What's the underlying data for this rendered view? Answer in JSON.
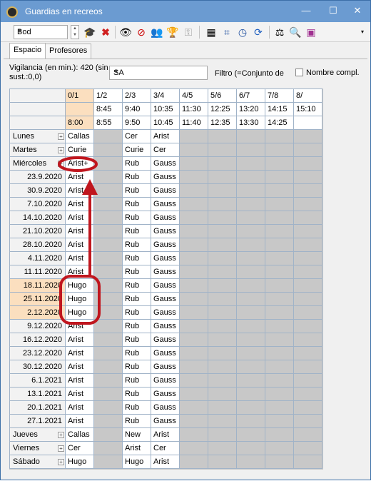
{
  "window": {
    "title": "Guardias en recreos"
  },
  "toolbar": {
    "combo_value": "Bod",
    "icons": [
      "graduation-cap-icon",
      "delete-x-icon",
      "eye-icon",
      "eye-crossed-icon",
      "people-icon",
      "trophy-icon",
      "key-icon",
      "calculator-icon",
      "crop-icon",
      "clock-icon",
      "refresh-icon",
      "scale-icon",
      "report-icon",
      "card-icon"
    ]
  },
  "tabs": [
    {
      "label": "Espacio"
    },
    {
      "label": "Profesores"
    }
  ],
  "filters": {
    "vigilancia_label": "Vigilancia (en min.): 420 (sin sust.:0,0)",
    "space_value": "SA",
    "filtro_label": "Filtro (=Conjunto de",
    "nombre_label": "Nombre compl."
  },
  "columns": [
    {
      "label": "0/1",
      "start": "",
      "end": "8:00"
    },
    {
      "label": "1/2",
      "start": "8:45",
      "end": "8:55"
    },
    {
      "label": "2/3",
      "start": "9:40",
      "end": "9:50"
    },
    {
      "label": "3/4",
      "start": "10:35",
      "end": "10:45"
    },
    {
      "label": "4/5",
      "start": "11:30",
      "end": "11:40"
    },
    {
      "label": "5/6",
      "start": "12:25",
      "end": "12:35"
    },
    {
      "label": "6/7",
      "start": "13:20",
      "end": "13:30"
    },
    {
      "label": "7/8",
      "start": "14:15",
      "end": "14:25"
    },
    {
      "label": "8/",
      "start": "15:10",
      "end": ""
    }
  ],
  "rows": [
    {
      "label": "Lunes",
      "type": "day",
      "cells": [
        "Callas",
        "",
        "Cer",
        "Arist"
      ]
    },
    {
      "label": "Martes",
      "type": "day",
      "cells": [
        "Curie",
        "",
        "Curie",
        "Cer"
      ]
    },
    {
      "label": "Miércoles",
      "type": "day",
      "cells": [
        "Arist+",
        "",
        "Rub",
        "Gauss"
      ]
    },
    {
      "label": "23.9.2020",
      "type": "date",
      "cells": [
        "Arist",
        "",
        "Rub",
        "Gauss"
      ]
    },
    {
      "label": "30.9.2020",
      "type": "date",
      "cells": [
        "Arist",
        "",
        "Rub",
        "Gauss"
      ]
    },
    {
      "label": "7.10.2020",
      "type": "date",
      "cells": [
        "Arist",
        "",
        "Rub",
        "Gauss"
      ]
    },
    {
      "label": "14.10.2020",
      "type": "date",
      "cells": [
        "Arist",
        "",
        "Rub",
        "Gauss"
      ]
    },
    {
      "label": "21.10.2020",
      "type": "date",
      "cells": [
        "Arist",
        "",
        "Rub",
        "Gauss"
      ]
    },
    {
      "label": "28.10.2020",
      "type": "date",
      "cells": [
        "Arist",
        "",
        "Rub",
        "Gauss"
      ]
    },
    {
      "label": "4.11.2020",
      "type": "date",
      "cells": [
        "Arist",
        "",
        "Rub",
        "Gauss"
      ]
    },
    {
      "label": "11.11.2020",
      "type": "date",
      "cells": [
        "Arist",
        "",
        "Rub",
        "Gauss"
      ]
    },
    {
      "label": "18.11.2020",
      "type": "date",
      "highlight": true,
      "cells": [
        "Hugo",
        "",
        "Rub",
        "Gauss"
      ]
    },
    {
      "label": "25.11.2020",
      "type": "date",
      "highlight": true,
      "cells": [
        "Hugo",
        "",
        "Rub",
        "Gauss"
      ]
    },
    {
      "label": "2.12.2020",
      "type": "date",
      "highlight": true,
      "cells": [
        "Hugo",
        "",
        "Rub",
        "Gauss"
      ]
    },
    {
      "label": "9.12.2020",
      "type": "date",
      "cells": [
        "Arist",
        "",
        "Rub",
        "Gauss"
      ]
    },
    {
      "label": "16.12.2020",
      "type": "date",
      "cells": [
        "Arist",
        "",
        "Rub",
        "Gauss"
      ]
    },
    {
      "label": "23.12.2020",
      "type": "date",
      "cells": [
        "Arist",
        "",
        "Rub",
        "Gauss"
      ]
    },
    {
      "label": "30.12.2020",
      "type": "date",
      "cells": [
        "Arist",
        "",
        "Rub",
        "Gauss"
      ]
    },
    {
      "label": "6.1.2021",
      "type": "date",
      "cells": [
        "Arist",
        "",
        "Rub",
        "Gauss"
      ]
    },
    {
      "label": "13.1.2021",
      "type": "date",
      "cells": [
        "Arist",
        "",
        "Rub",
        "Gauss"
      ]
    },
    {
      "label": "20.1.2021",
      "type": "date",
      "cells": [
        "Arist",
        "",
        "Rub",
        "Gauss"
      ]
    },
    {
      "label": "27.1.2021",
      "type": "date",
      "cells": [
        "Arist",
        "",
        "Rub",
        "Gauss"
      ]
    },
    {
      "label": "Jueves",
      "type": "day",
      "cells": [
        "Callas",
        "",
        "New",
        "Arist"
      ]
    },
    {
      "label": "Viernes",
      "type": "day",
      "cells": [
        "Cer",
        "",
        "Arist",
        "Cer"
      ]
    },
    {
      "label": "Sábado",
      "type": "day",
      "cells": [
        "Hugo",
        "",
        "Hugo",
        "Arist"
      ]
    }
  ],
  "colors": {
    "accent": "#6b9bd1",
    "highlight": "#fbdfbf",
    "annotation": "#c0161e"
  }
}
